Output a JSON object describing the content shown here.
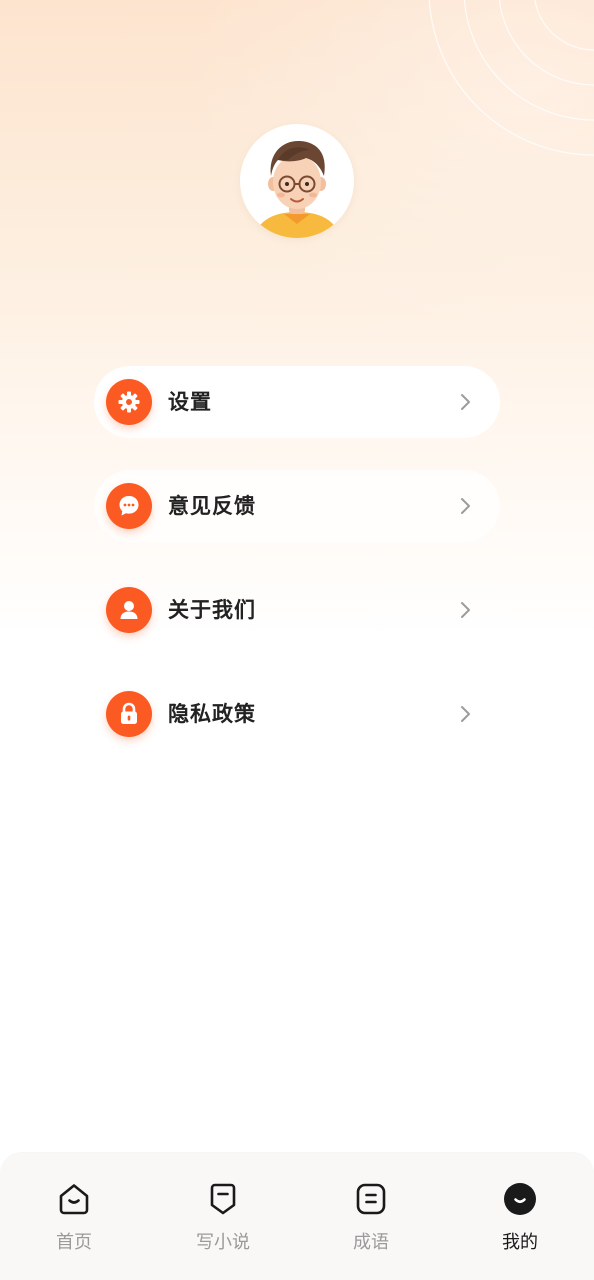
{
  "menu": {
    "items": [
      {
        "label": "设置",
        "icon": "gear-icon"
      },
      {
        "label": "意见反馈",
        "icon": "chat-bubble-icon"
      },
      {
        "label": "关于我们",
        "icon": "person-icon"
      },
      {
        "label": "隐私政策",
        "icon": "lock-icon"
      }
    ]
  },
  "tabbar": {
    "tabs": [
      {
        "label": "首页",
        "icon": "home-icon",
        "active": false
      },
      {
        "label": "写小说",
        "icon": "write-novel-icon",
        "active": false
      },
      {
        "label": "成语",
        "icon": "idiom-icon",
        "active": false
      },
      {
        "label": "我的",
        "icon": "mine-icon",
        "active": true
      }
    ]
  },
  "colors": {
    "accent": "#fb5b22",
    "background_top": "#fde4cf",
    "tab_inactive": "#9a9a9a",
    "tab_active": "#1a1a1a"
  }
}
